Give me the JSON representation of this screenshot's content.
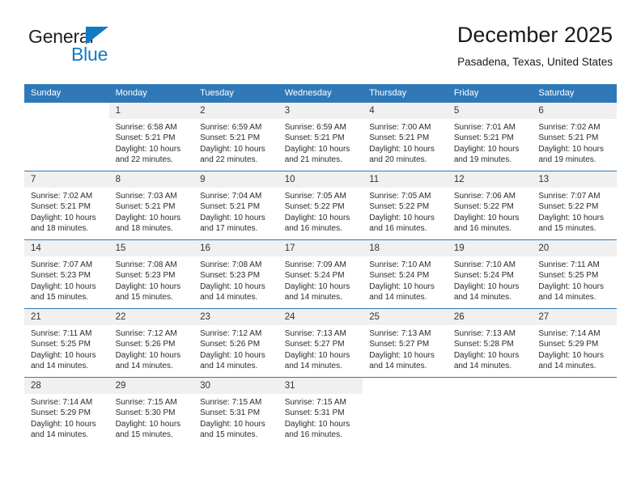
{
  "brand": {
    "name_top": "General",
    "name_bottom": "Blue",
    "accent_color": "#1279c3"
  },
  "header": {
    "title": "December 2025",
    "location": "Pasadena, Texas, United States"
  },
  "theme": {
    "header_row_bg": "#3079b8",
    "header_row_text": "#ffffff",
    "daynum_bg": "#f0f0f0",
    "row_divider": "#3079b8"
  },
  "weekdays": [
    "Sunday",
    "Monday",
    "Tuesday",
    "Wednesday",
    "Thursday",
    "Friday",
    "Saturday"
  ],
  "labels": {
    "sunrise_prefix": "Sunrise: ",
    "sunset_prefix": "Sunset: ",
    "daylight_prefix": "Daylight: "
  },
  "weeks": [
    [
      {
        "empty": true
      },
      {
        "day": "1",
        "sunrise": "Sunrise: 6:58 AM",
        "sunset": "Sunset: 5:21 PM",
        "daylight": "Daylight: 10 hours and 22 minutes."
      },
      {
        "day": "2",
        "sunrise": "Sunrise: 6:59 AM",
        "sunset": "Sunset: 5:21 PM",
        "daylight": "Daylight: 10 hours and 22 minutes."
      },
      {
        "day": "3",
        "sunrise": "Sunrise: 6:59 AM",
        "sunset": "Sunset: 5:21 PM",
        "daylight": "Daylight: 10 hours and 21 minutes."
      },
      {
        "day": "4",
        "sunrise": "Sunrise: 7:00 AM",
        "sunset": "Sunset: 5:21 PM",
        "daylight": "Daylight: 10 hours and 20 minutes."
      },
      {
        "day": "5",
        "sunrise": "Sunrise: 7:01 AM",
        "sunset": "Sunset: 5:21 PM",
        "daylight": "Daylight: 10 hours and 19 minutes."
      },
      {
        "day": "6",
        "sunrise": "Sunrise: 7:02 AM",
        "sunset": "Sunset: 5:21 PM",
        "daylight": "Daylight: 10 hours and 19 minutes."
      }
    ],
    [
      {
        "day": "7",
        "sunrise": "Sunrise: 7:02 AM",
        "sunset": "Sunset: 5:21 PM",
        "daylight": "Daylight: 10 hours and 18 minutes."
      },
      {
        "day": "8",
        "sunrise": "Sunrise: 7:03 AM",
        "sunset": "Sunset: 5:21 PM",
        "daylight": "Daylight: 10 hours and 18 minutes."
      },
      {
        "day": "9",
        "sunrise": "Sunrise: 7:04 AM",
        "sunset": "Sunset: 5:21 PM",
        "daylight": "Daylight: 10 hours and 17 minutes."
      },
      {
        "day": "10",
        "sunrise": "Sunrise: 7:05 AM",
        "sunset": "Sunset: 5:22 PM",
        "daylight": "Daylight: 10 hours and 16 minutes."
      },
      {
        "day": "11",
        "sunrise": "Sunrise: 7:05 AM",
        "sunset": "Sunset: 5:22 PM",
        "daylight": "Daylight: 10 hours and 16 minutes."
      },
      {
        "day": "12",
        "sunrise": "Sunrise: 7:06 AM",
        "sunset": "Sunset: 5:22 PM",
        "daylight": "Daylight: 10 hours and 16 minutes."
      },
      {
        "day": "13",
        "sunrise": "Sunrise: 7:07 AM",
        "sunset": "Sunset: 5:22 PM",
        "daylight": "Daylight: 10 hours and 15 minutes."
      }
    ],
    [
      {
        "day": "14",
        "sunrise": "Sunrise: 7:07 AM",
        "sunset": "Sunset: 5:23 PM",
        "daylight": "Daylight: 10 hours and 15 minutes."
      },
      {
        "day": "15",
        "sunrise": "Sunrise: 7:08 AM",
        "sunset": "Sunset: 5:23 PM",
        "daylight": "Daylight: 10 hours and 15 minutes."
      },
      {
        "day": "16",
        "sunrise": "Sunrise: 7:08 AM",
        "sunset": "Sunset: 5:23 PM",
        "daylight": "Daylight: 10 hours and 14 minutes."
      },
      {
        "day": "17",
        "sunrise": "Sunrise: 7:09 AM",
        "sunset": "Sunset: 5:24 PM",
        "daylight": "Daylight: 10 hours and 14 minutes."
      },
      {
        "day": "18",
        "sunrise": "Sunrise: 7:10 AM",
        "sunset": "Sunset: 5:24 PM",
        "daylight": "Daylight: 10 hours and 14 minutes."
      },
      {
        "day": "19",
        "sunrise": "Sunrise: 7:10 AM",
        "sunset": "Sunset: 5:24 PM",
        "daylight": "Daylight: 10 hours and 14 minutes."
      },
      {
        "day": "20",
        "sunrise": "Sunrise: 7:11 AM",
        "sunset": "Sunset: 5:25 PM",
        "daylight": "Daylight: 10 hours and 14 minutes."
      }
    ],
    [
      {
        "day": "21",
        "sunrise": "Sunrise: 7:11 AM",
        "sunset": "Sunset: 5:25 PM",
        "daylight": "Daylight: 10 hours and 14 minutes."
      },
      {
        "day": "22",
        "sunrise": "Sunrise: 7:12 AM",
        "sunset": "Sunset: 5:26 PM",
        "daylight": "Daylight: 10 hours and 14 minutes."
      },
      {
        "day": "23",
        "sunrise": "Sunrise: 7:12 AM",
        "sunset": "Sunset: 5:26 PM",
        "daylight": "Daylight: 10 hours and 14 minutes."
      },
      {
        "day": "24",
        "sunrise": "Sunrise: 7:13 AM",
        "sunset": "Sunset: 5:27 PM",
        "daylight": "Daylight: 10 hours and 14 minutes."
      },
      {
        "day": "25",
        "sunrise": "Sunrise: 7:13 AM",
        "sunset": "Sunset: 5:27 PM",
        "daylight": "Daylight: 10 hours and 14 minutes."
      },
      {
        "day": "26",
        "sunrise": "Sunrise: 7:13 AM",
        "sunset": "Sunset: 5:28 PM",
        "daylight": "Daylight: 10 hours and 14 minutes."
      },
      {
        "day": "27",
        "sunrise": "Sunrise: 7:14 AM",
        "sunset": "Sunset: 5:29 PM",
        "daylight": "Daylight: 10 hours and 14 minutes."
      }
    ],
    [
      {
        "day": "28",
        "sunrise": "Sunrise: 7:14 AM",
        "sunset": "Sunset: 5:29 PM",
        "daylight": "Daylight: 10 hours and 14 minutes."
      },
      {
        "day": "29",
        "sunrise": "Sunrise: 7:15 AM",
        "sunset": "Sunset: 5:30 PM",
        "daylight": "Daylight: 10 hours and 15 minutes."
      },
      {
        "day": "30",
        "sunrise": "Sunrise: 7:15 AM",
        "sunset": "Sunset: 5:31 PM",
        "daylight": "Daylight: 10 hours and 15 minutes."
      },
      {
        "day": "31",
        "sunrise": "Sunrise: 7:15 AM",
        "sunset": "Sunset: 5:31 PM",
        "daylight": "Daylight: 10 hours and 16 minutes."
      },
      {
        "empty": true
      },
      {
        "empty": true
      },
      {
        "empty": true
      }
    ]
  ]
}
